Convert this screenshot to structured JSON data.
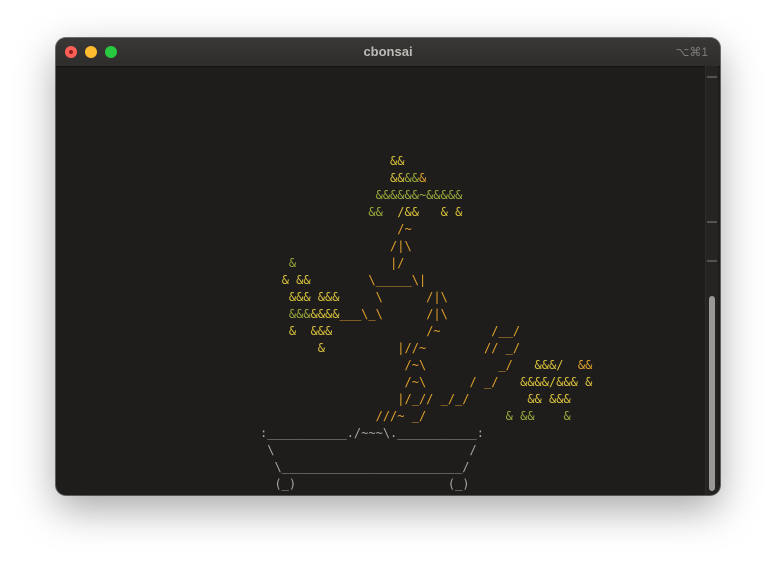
{
  "window": {
    "title": "cbonsai",
    "shortcut": "⌥⌘1"
  },
  "colors": {
    "leaf_green": "#9aa83a",
    "leaf_yellow": "#d8c13a",
    "trunk_orange": "#e0a12a",
    "pot_gray": "#a8a6a2",
    "background": "#1f1d1b"
  },
  "art_lines": [
    [
      {
        "t": "                  ",
        "c": "g"
      },
      {
        "t": "&&",
        "c": "y"
      }
    ],
    [
      {
        "t": "                  ",
        "c": "g"
      },
      {
        "t": "&&",
        "c": "y"
      },
      {
        "t": "&&",
        "c": "g"
      },
      {
        "t": "&",
        "c": "o"
      }
    ],
    [
      {
        "t": "                ",
        "c": "g"
      },
      {
        "t": "&&&&&&~&&&&&",
        "c": "g"
      }
    ],
    [
      {
        "t": "               ",
        "c": "g"
      },
      {
        "t": "&&  ",
        "c": "g"
      },
      {
        "t": "/&&   & &",
        "c": "y"
      }
    ],
    [
      {
        "t": "                   ",
        "c": "g"
      },
      {
        "t": "/~",
        "c": "o"
      }
    ],
    [
      {
        "t": "                  ",
        "c": "g"
      },
      {
        "t": "/|\\",
        "c": "o"
      }
    ],
    [
      {
        "t": "    ",
        "c": "g"
      },
      {
        "t": "&",
        "c": "g"
      },
      {
        "t": "             ",
        "c": "g"
      },
      {
        "t": "|/",
        "c": "o"
      }
    ],
    [
      {
        "t": "   ",
        "c": "g"
      },
      {
        "t": "& &&",
        "c": "y"
      },
      {
        "t": "        ",
        "c": "g"
      },
      {
        "t": "\\_____\\|",
        "c": "o"
      }
    ],
    [
      {
        "t": "    ",
        "c": "g"
      },
      {
        "t": "&&& &&&",
        "c": "y"
      },
      {
        "t": "     ",
        "c": "g"
      },
      {
        "t": "\\      /|\\",
        "c": "o"
      }
    ],
    [
      {
        "t": "    ",
        "c": "g"
      },
      {
        "t": "&&&",
        "c": "g"
      },
      {
        "t": "&&&&",
        "c": "y"
      },
      {
        "t": "___\\_\\      /|\\",
        "c": "o"
      }
    ],
    [
      {
        "t": "    ",
        "c": "g"
      },
      {
        "t": "&  &&&",
        "c": "y"
      },
      {
        "t": "             ",
        "c": "g"
      },
      {
        "t": "/~       /__/",
        "c": "o"
      }
    ],
    [
      {
        "t": "        ",
        "c": "g"
      },
      {
        "t": "&",
        "c": "y"
      },
      {
        "t": "          ",
        "c": "g"
      },
      {
        "t": "|//~        // _/",
        "c": "o"
      }
    ],
    [
      {
        "t": "                    ",
        "c": "g"
      },
      {
        "t": "/~\\          _/   ",
        "c": "o"
      },
      {
        "t": "&&&/  ",
        "c": "y"
      },
      {
        "t": "&&",
        "c": "o"
      }
    ],
    [
      {
        "t": "                    ",
        "c": "g"
      },
      {
        "t": "/~\\      / _/   ",
        "c": "o"
      },
      {
        "t": "&&&&/&&& &",
        "c": "y"
      }
    ],
    [
      {
        "t": "                   ",
        "c": "g"
      },
      {
        "t": "|/_// _/_/",
        "c": "o"
      },
      {
        "t": "        ",
        "c": "g"
      },
      {
        "t": "&& &&&",
        "c": "y"
      }
    ],
    [
      {
        "t": "                ",
        "c": "g"
      },
      {
        "t": "///~ _/",
        "c": "o"
      },
      {
        "t": "           ",
        "c": "g"
      },
      {
        "t": "& &&    &",
        "c": "g"
      }
    ],
    [
      {
        "t": ":___________./~~~\\.___________:",
        "c": "p"
      }
    ],
    [
      {
        "t": " \\                           /",
        "c": "p"
      }
    ],
    [
      {
        "t": "  \\_________________________/",
        "c": "p"
      }
    ],
    [
      {
        "t": "  (_)                     (_)",
        "c": "p"
      }
    ]
  ]
}
